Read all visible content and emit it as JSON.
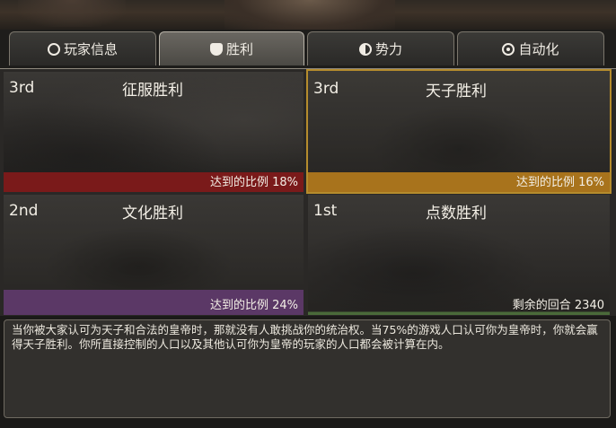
{
  "tabs": [
    {
      "label": "玩家信息",
      "icon": "circle-icon",
      "active": false
    },
    {
      "label": "胜利",
      "icon": "shield-icon",
      "active": true
    },
    {
      "label": "势力",
      "icon": "half-circle-icon",
      "active": false
    },
    {
      "label": "自动化",
      "icon": "gear-icon",
      "active": false
    }
  ],
  "victories": [
    {
      "rank": "3rd",
      "title": "征服胜利",
      "status": "达到的比例  18%",
      "progress": 0.18,
      "bar_color": "#7a1a1a",
      "selected": false
    },
    {
      "rank": "3rd",
      "title": "天子胜利",
      "status": "达到的比例  16%",
      "progress": 0.16,
      "bar_color": "#a8731c",
      "selected": true
    },
    {
      "rank": "2nd",
      "title": "文化胜利",
      "status": "达到的比例  24%",
      "progress": 0.24,
      "bar_color": "#5b3866",
      "selected": false
    },
    {
      "rank": "1st",
      "title": "点数胜利",
      "status": "剩余的回合 2340",
      "bar_color": "#3b4a34",
      "selected": false
    }
  ],
  "description": "当你被大家认可为天子和合法的皇帝时，那就没有人敢挑战你的统治权。当75%的游戏人口认可你为皇帝时，你就会赢得天子胜利。你所直接控制的人口以及其他认可你为皇帝的玩家的人口都会被计算在内。"
}
